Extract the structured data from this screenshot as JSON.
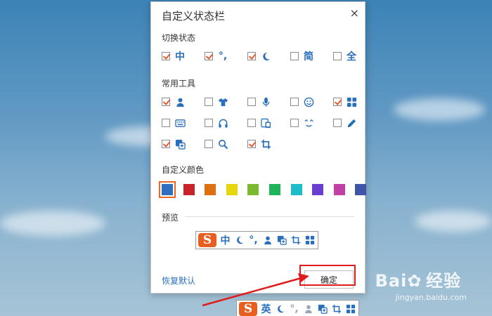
{
  "dialog": {
    "title": "自定义状态栏",
    "close_icon": "×"
  },
  "switch_state": {
    "label": "切换状态",
    "items": [
      {
        "icon": "中",
        "checked": true
      },
      {
        "icon": "°,",
        "checked": true
      },
      {
        "icon": "moon-icon",
        "checked": true
      },
      {
        "icon": "简",
        "checked": false
      },
      {
        "icon": "全",
        "checked": false
      }
    ]
  },
  "common_tools": {
    "label": "常用工具",
    "items": [
      {
        "icon": "user-icon",
        "checked": true
      },
      {
        "icon": "tshirt-icon",
        "checked": false
      },
      {
        "icon": "microphone-icon",
        "checked": false
      },
      {
        "icon": "smiley-icon",
        "checked": false
      },
      {
        "icon": "grid-icon",
        "checked": true
      },
      {
        "icon": "keyboard-icon",
        "checked": false
      },
      {
        "icon": "headphones-icon",
        "checked": false
      },
      {
        "icon": "devices-icon",
        "checked": false
      },
      {
        "icon": "wink-icon",
        "checked": false
      },
      {
        "icon": "pencil-icon",
        "checked": false
      },
      {
        "icon": "clipboard-icon",
        "checked": true
      },
      {
        "icon": "search-icon",
        "checked": false
      },
      {
        "icon": "crop-icon",
        "checked": true
      }
    ]
  },
  "custom_color": {
    "label": "自定义颜色",
    "swatches": [
      "#2e6fc0",
      "#c8222a",
      "#e0700f",
      "#e6d60c",
      "#7cb930",
      "#1fb35a",
      "#1cbccb",
      "#6a3fcf",
      "#c13fa7",
      "#3f55a8"
    ],
    "selected_index": 0
  },
  "preview": {
    "label": "预览",
    "logo": "S",
    "icons": [
      "中",
      "moon-icon",
      "°,",
      "user-icon",
      "clipboard-icon",
      "crop-icon",
      "grid-icon"
    ]
  },
  "footer": {
    "restore": "恢复默认",
    "ok": "确定"
  },
  "bottom_bar": {
    "logo": "S",
    "icons": [
      "英",
      "moon-icon",
      "°,",
      "user-icon",
      "clipboard-icon",
      "crop-icon",
      "grid-icon"
    ]
  },
  "watermark": {
    "brand": "Bai",
    "brand2": "经验",
    "sub": "jingyan.baidu.com"
  },
  "colors": {
    "accent": "#2a6fbd",
    "check": "#e45a33",
    "highlight": "#e01b1b",
    "logo": "#e85e20"
  }
}
